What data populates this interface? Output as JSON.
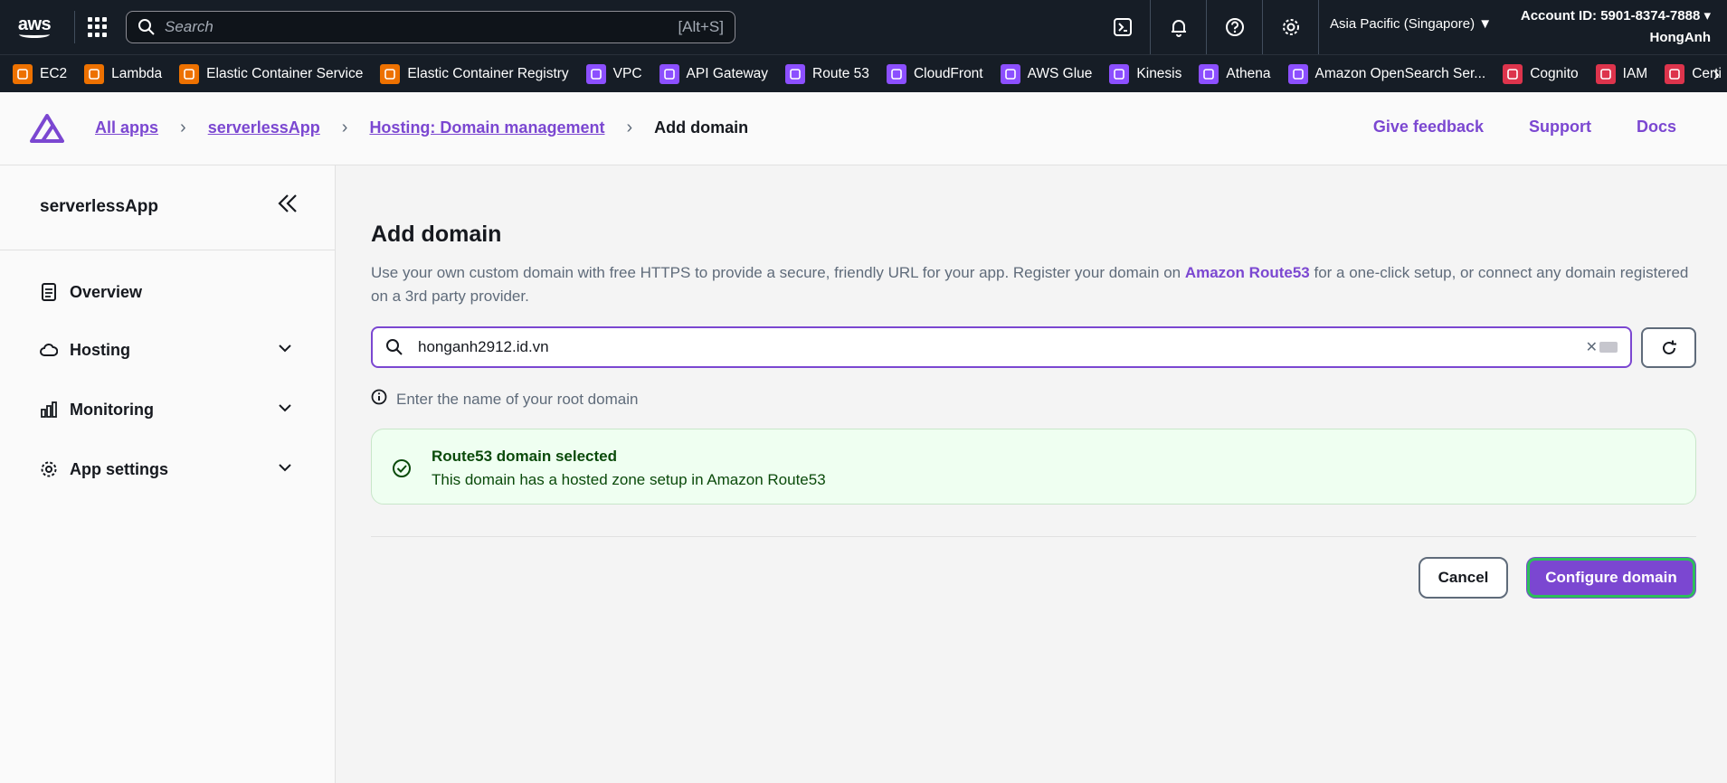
{
  "topnav": {
    "logo_text": "aws",
    "search_placeholder": "Search",
    "search_shortcut": "[Alt+S]",
    "region": "Asia Pacific (Singapore) ▼",
    "account_id": "Account ID: 5901-8374-7888 ▾",
    "username": "HongAnh"
  },
  "favorites": [
    {
      "label": "EC2",
      "icon": "ec2-icon",
      "color": "#ed7100"
    },
    {
      "label": "Lambda",
      "icon": "lambda-icon",
      "color": "#ed7100"
    },
    {
      "label": "Elastic Container Service",
      "icon": "ecs-icon",
      "color": "#ed7100"
    },
    {
      "label": "Elastic Container Registry",
      "icon": "ecr-icon",
      "color": "#ed7100"
    },
    {
      "label": "VPC",
      "icon": "vpc-icon",
      "color": "#8c4fff"
    },
    {
      "label": "API Gateway",
      "icon": "api-gateway-icon",
      "color": "#8c4fff"
    },
    {
      "label": "Route 53",
      "icon": "route53-icon",
      "color": "#8c4fff"
    },
    {
      "label": "CloudFront",
      "icon": "cloudfront-icon",
      "color": "#8c4fff"
    },
    {
      "label": "AWS Glue",
      "icon": "glue-icon",
      "color": "#8c4fff"
    },
    {
      "label": "Kinesis",
      "icon": "kinesis-icon",
      "color": "#8c4fff"
    },
    {
      "label": "Athena",
      "icon": "athena-icon",
      "color": "#8c4fff"
    },
    {
      "label": "Amazon OpenSearch Ser...",
      "icon": "opensearch-icon",
      "color": "#8c4fff"
    },
    {
      "label": "Cognito",
      "icon": "cognito-icon",
      "color": "#dd344c"
    },
    {
      "label": "IAM",
      "icon": "iam-icon",
      "color": "#dd344c"
    },
    {
      "label": "Certi",
      "icon": "certificate-icon",
      "color": "#dd344c"
    }
  ],
  "breadcrumb": {
    "items": [
      "All apps",
      "serverlessApp",
      "Hosting: Domain management"
    ],
    "current": "Add domain"
  },
  "header_links": {
    "feedback": "Give feedback",
    "support": "Support",
    "docs": "Docs"
  },
  "sidebar": {
    "title": "serverlessApp",
    "items": [
      {
        "label": "Overview"
      },
      {
        "label": "Hosting"
      },
      {
        "label": "Monitoring"
      },
      {
        "label": "App settings"
      }
    ]
  },
  "main": {
    "title": "Add domain",
    "desc_before": "Use your own custom domain with free HTTPS to provide a secure, friendly URL for your app. Register your domain on ",
    "desc_link": "Amazon Route53",
    "desc_after": " for a one-click setup, or connect any domain registered on a 3rd party provider.",
    "domain_value": "honganh2912.id.vn",
    "hint": "Enter the name of your root domain",
    "alert_title": "Route53 domain selected",
    "alert_body": "This domain has a hosted zone setup in Amazon Route53",
    "cancel_label": "Cancel",
    "configure_label": "Configure domain"
  },
  "colors": {
    "brand_purple": "#7b47d1",
    "nav_bg": "#161d26",
    "success_bg": "#effff1",
    "focus_green": "#2dbf5a"
  }
}
